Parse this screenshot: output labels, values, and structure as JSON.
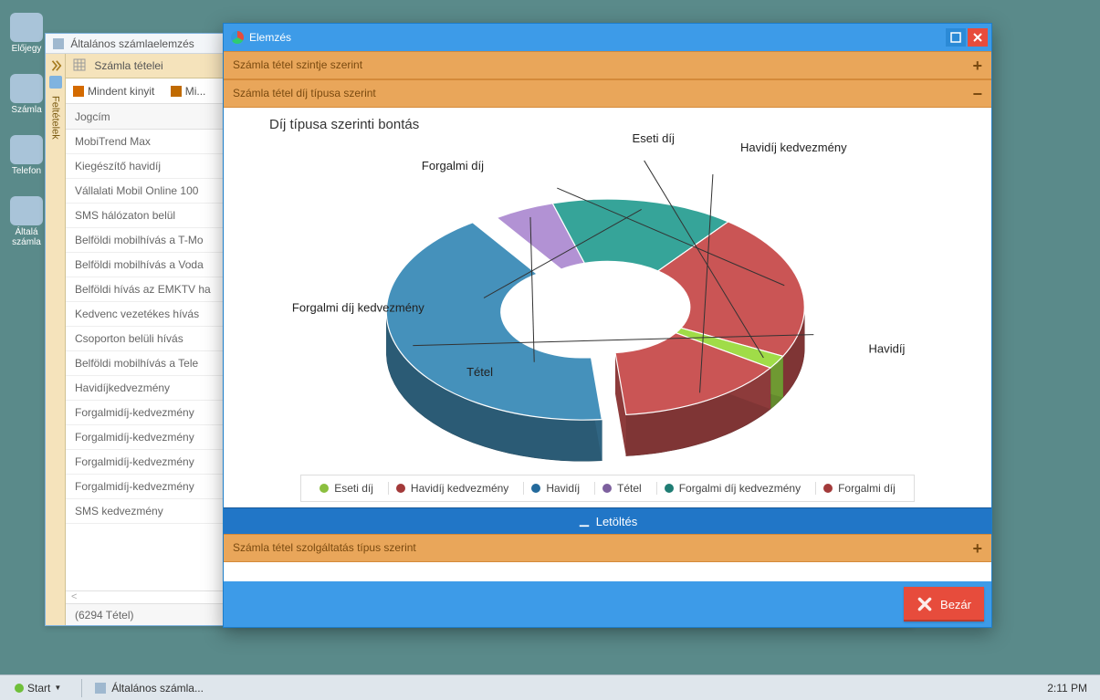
{
  "desktop_icons": [
    "Előjegy",
    "Számla",
    "Telefon",
    "Általá számla"
  ],
  "bg_window": {
    "title": "Általános számlaelemzés",
    "sidebar_label": "Feltételek",
    "section_header": "Számla tételei",
    "toolbar": {
      "expand": "Mindent kinyit",
      "collapse": "Mi..."
    },
    "column_header": "Jogcím",
    "items": [
      "MobiTrend Max",
      "Kiegészítő havidíj",
      "Vállalati Mobil Online 100",
      "SMS hálózaton belül",
      "Belföldi mobilhívás a T-Mo",
      "Belföldi mobilhívás a Voda",
      "Belföldi hívás az EMKTV ha",
      "Kedvenc vezetékes hívás",
      "Csoporton belüli hívás",
      "Belföldi mobilhívás a Tele",
      "Havidíjkedvezmény",
      "Forgalmidíj-kedvezmény",
      "Forgalmidíj-kedvezmény",
      "Forgalmidíj-kedvezmény",
      "Forgalmidíj-kedvezmény",
      "SMS kedvezmény"
    ],
    "footer_marker": "<",
    "footer_total": "(6294 Tétel)"
  },
  "modal": {
    "title": "Elemzés",
    "accordion": {
      "a1": "Számla tétel szintje szerint",
      "a2": "Számla tétel díj típusa szerint",
      "a3": "Számla tétel szolgáltatás típus szerint"
    },
    "chart_title": "Díj típusa szerinti bontás",
    "legend": [
      {
        "label": "Eseti díj",
        "color": "#8bbf3f"
      },
      {
        "label": "Havidíj kedvezmény",
        "color": "#a33a3a"
      },
      {
        "label": "Havidíj",
        "color": "#246a9c"
      },
      {
        "label": "Tétel",
        "color": "#7d609e"
      },
      {
        "label": "Forgalmi díj kedvezmény",
        "color": "#1f7d74"
      },
      {
        "label": "Forgalmi díj",
        "color": "#a33a3a"
      }
    ],
    "download": "Letöltés",
    "close": "Bezár"
  },
  "taskbar": {
    "start": "Start",
    "task": "Általános számla...",
    "clock": "2:11 PM"
  },
  "chart_data": {
    "type": "pie",
    "title": "Díj típusa szerinti bontás",
    "series": [
      {
        "name": "Havidíj",
        "value": 42,
        "color": "#3c7ea3"
      },
      {
        "name": "Tétel",
        "value": 5,
        "color": "#9b7fb8"
      },
      {
        "name": "Forgalmi díj kedvezmény",
        "value": 15,
        "color": "#2f8f85"
      },
      {
        "name": "Forgalmi díj",
        "value": 22,
        "color": "#b04a4a"
      },
      {
        "name": "Eseti díj",
        "value": 2,
        "color": "#8bbf3f"
      },
      {
        "name": "Havidíj kedvezmény",
        "value": 14,
        "color": "#b04a4a"
      }
    ],
    "note": "3D donut (ring), first slice (Havidíj) exploded; percentages estimated from visual proportions"
  }
}
